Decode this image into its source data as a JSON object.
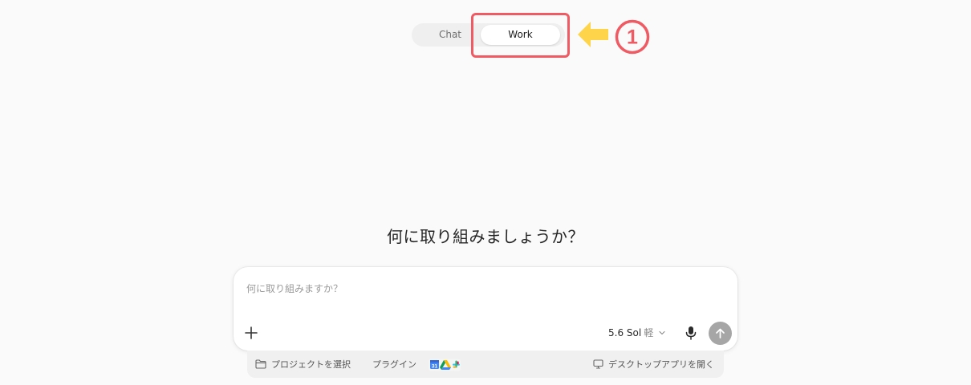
{
  "mode_toggle": {
    "chat_label": "Chat",
    "work_label": "Work",
    "selected": "Work"
  },
  "annotation": {
    "step_number": "1",
    "highlight_color": "#ef5a63",
    "arrow_color": "#fdd44a"
  },
  "heading": "何に取り組みましょうか？",
  "composer": {
    "placeholder": "何に取り組みますか？",
    "value": "",
    "model_name": "5.6 Sol",
    "model_mode": "軽"
  },
  "footer": {
    "project_label": "プロジェクトを選択",
    "plugin_label": "プラグイン",
    "desktop_label": "デスクトップアプリを開く"
  },
  "icons": {
    "attach": "plus-icon",
    "model_dropdown": "chevron-down-icon",
    "mic": "microphone-icon",
    "send": "arrow-up-icon",
    "project": "folder-icon",
    "plugins": [
      "calendar-icon",
      "drive-icon",
      "slack-icon"
    ],
    "desktop": "monitor-icon"
  },
  "colors": {
    "background": "#fafafa",
    "send_button": "#a6a6a6",
    "footer_bar": "#f0f0f0"
  }
}
